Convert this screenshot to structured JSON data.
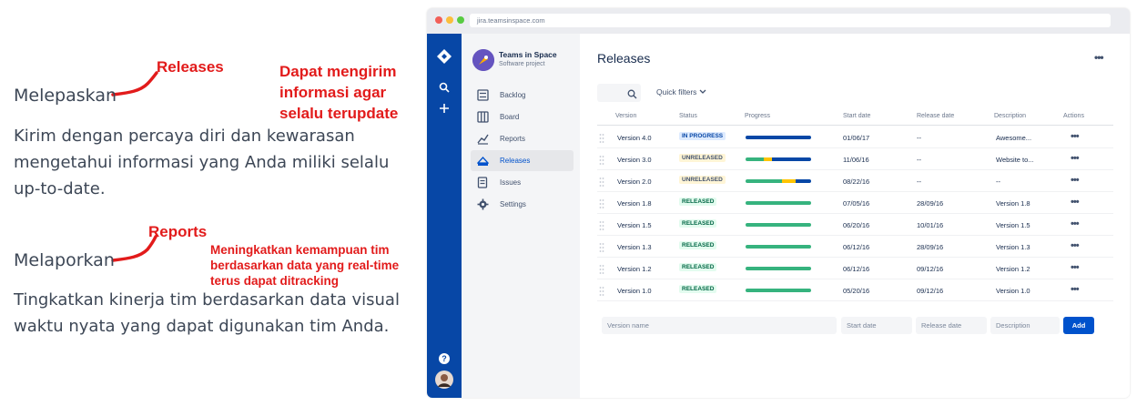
{
  "left_panel": {
    "section1": {
      "heading": "Melepaskan",
      "annotation": "Releases",
      "side_note_lines": [
        "Dapat mengirim",
        "informasi agar",
        "selalu terupdate"
      ],
      "body_lines": [
        "Kirim dengan percaya diri dan kewarasan",
        "mengetahui informasi yang Anda miliki selalu",
        "up-to-date."
      ]
    },
    "section2": {
      "heading": "Melaporkan",
      "annotation": "Reports",
      "side_note_lines": [
        "Meningkatkan kemampuan tim",
        "berdasarkan data yang real-time",
        "terus dapat ditracking"
      ],
      "body_lines": [
        "Tingkatkan kinerja tim berdasarkan data visual",
        "waktu nyata yang dapat digunakan tim Anda."
      ]
    },
    "annotation_color": "#e21b1b"
  },
  "browser": {
    "url": "jira.teamsinspace.com",
    "window_dots": [
      "#f25f58",
      "#fbbe3c",
      "#58cb42"
    ]
  },
  "global_nav": {
    "items": [
      {
        "icon": "jira-logo-icon"
      },
      {
        "icon": "search-icon"
      },
      {
        "icon": "plus-icon"
      }
    ],
    "bottom": [
      {
        "icon": "help-icon",
        "label": "?"
      },
      {
        "icon": "user-avatar"
      }
    ],
    "color": "#0747a6"
  },
  "project": {
    "name": "Teams in Space",
    "type": "Software project",
    "nav_items": [
      {
        "label": "Backlog",
        "icon": "backlog-icon",
        "active": false
      },
      {
        "label": "Board",
        "icon": "board-icon",
        "active": false
      },
      {
        "label": "Reports",
        "icon": "reports-icon",
        "active": false
      },
      {
        "label": "Releases",
        "icon": "releases-icon",
        "active": true
      },
      {
        "label": "Issues",
        "icon": "issues-icon",
        "active": false
      },
      {
        "label": "Settings",
        "icon": "settings-icon",
        "active": false
      }
    ]
  },
  "main": {
    "title": "Releases",
    "more_label": "•••",
    "quick_filters": "Quick filters",
    "columns": [
      "Version",
      "Status",
      "Progress",
      "Start date",
      "Release date",
      "Description",
      "Actions"
    ],
    "rows": [
      {
        "version": "Version 4.0",
        "status": "IN PROGRESS",
        "status_kind": "progress",
        "progress": {
          "done": 0,
          "in_progress": 0,
          "todo": 1.0
        },
        "start": "01/06/17",
        "release": "--",
        "description": "Awesome...",
        "actions": "•••"
      },
      {
        "version": "Version 3.0",
        "status": "UNRELEASED",
        "status_kind": "unreleased",
        "progress": {
          "done": 0.28,
          "in_progress": 0.12,
          "todo": 0.6
        },
        "start": "11/06/16",
        "release": "--",
        "description": "Website to...",
        "actions": "•••"
      },
      {
        "version": "Version 2.0",
        "status": "UNRELEASED",
        "status_kind": "unreleased",
        "progress": {
          "done": 0.55,
          "in_progress": 0.22,
          "todo": 0.23
        },
        "start": "08/22/16",
        "release": "--",
        "description": "--",
        "actions": "•••"
      },
      {
        "version": "Version 1.8",
        "status": "RELEASED",
        "status_kind": "released",
        "progress": {
          "done": 1.0,
          "in_progress": 0,
          "todo": 0
        },
        "start": "07/05/16",
        "release": "28/09/16",
        "description": "Version 1.8",
        "actions": "•••"
      },
      {
        "version": "Version 1.5",
        "status": "RELEASED",
        "status_kind": "released",
        "progress": {
          "done": 1.0,
          "in_progress": 0,
          "todo": 0
        },
        "start": "06/20/16",
        "release": "10/01/16",
        "description": "Version 1.5",
        "actions": "•••"
      },
      {
        "version": "Version 1.3",
        "status": "RELEASED",
        "status_kind": "released",
        "progress": {
          "done": 1.0,
          "in_progress": 0,
          "todo": 0
        },
        "start": "06/12/16",
        "release": "28/09/16",
        "description": "Version 1.3",
        "actions": "•••"
      },
      {
        "version": "Version 1.2",
        "status": "RELEASED",
        "status_kind": "released",
        "progress": {
          "done": 1.0,
          "in_progress": 0,
          "todo": 0
        },
        "start": "06/12/16",
        "release": "09/12/16",
        "description": "Version 1.2",
        "actions": "•••"
      },
      {
        "version": "Version 1.0",
        "status": "RELEASED",
        "status_kind": "released",
        "progress": {
          "done": 1.0,
          "in_progress": 0,
          "todo": 0
        },
        "start": "05/20/16",
        "release": "09/12/16",
        "description": "Version 1.0",
        "actions": "•••"
      }
    ],
    "progress_colors": {
      "done": "#36b37e",
      "in_progress": "#ffc400",
      "todo": "#0747a6"
    },
    "add_form": {
      "version_placeholder": "Version name",
      "start_placeholder": "Start date",
      "release_placeholder": "Release date",
      "description_placeholder": "Description",
      "add_label": "Add"
    }
  }
}
